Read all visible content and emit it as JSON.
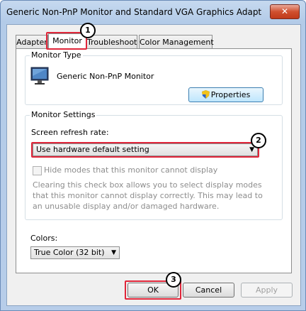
{
  "window": {
    "title": "Generic Non-PnP Monitor and Standard VGA Graphics Adapter Pro...",
    "close_icon": "close-x-icon"
  },
  "tabs": [
    {
      "label": "Adapter"
    },
    {
      "label": "Monitor",
      "active": true
    },
    {
      "label": "Troubleshoot"
    },
    {
      "label": "Color Management"
    }
  ],
  "monitor_type": {
    "legend": "Monitor Type",
    "name": "Generic Non-PnP Monitor",
    "properties_label": "Properties",
    "icon": "monitor-icon"
  },
  "monitor_settings": {
    "legend": "Monitor Settings",
    "refresh_label": "Screen refresh rate:",
    "refresh_value": "Use hardware default setting",
    "hide_modes_label": "Hide modes that this monitor cannot display",
    "hide_modes_checked": false,
    "description": "Clearing this check box allows you to select display modes that this monitor cannot display correctly. This may lead to an unusable display and/or damaged hardware."
  },
  "colors": {
    "label": "Colors:",
    "value": "True Color (32 bit)"
  },
  "buttons": {
    "ok": "OK",
    "cancel": "Cancel",
    "apply": "Apply"
  },
  "annotations": [
    "1",
    "2",
    "3"
  ],
  "accent_colors": {
    "highlight": "#e0263a",
    "titlebar": "#c6d9ef"
  }
}
